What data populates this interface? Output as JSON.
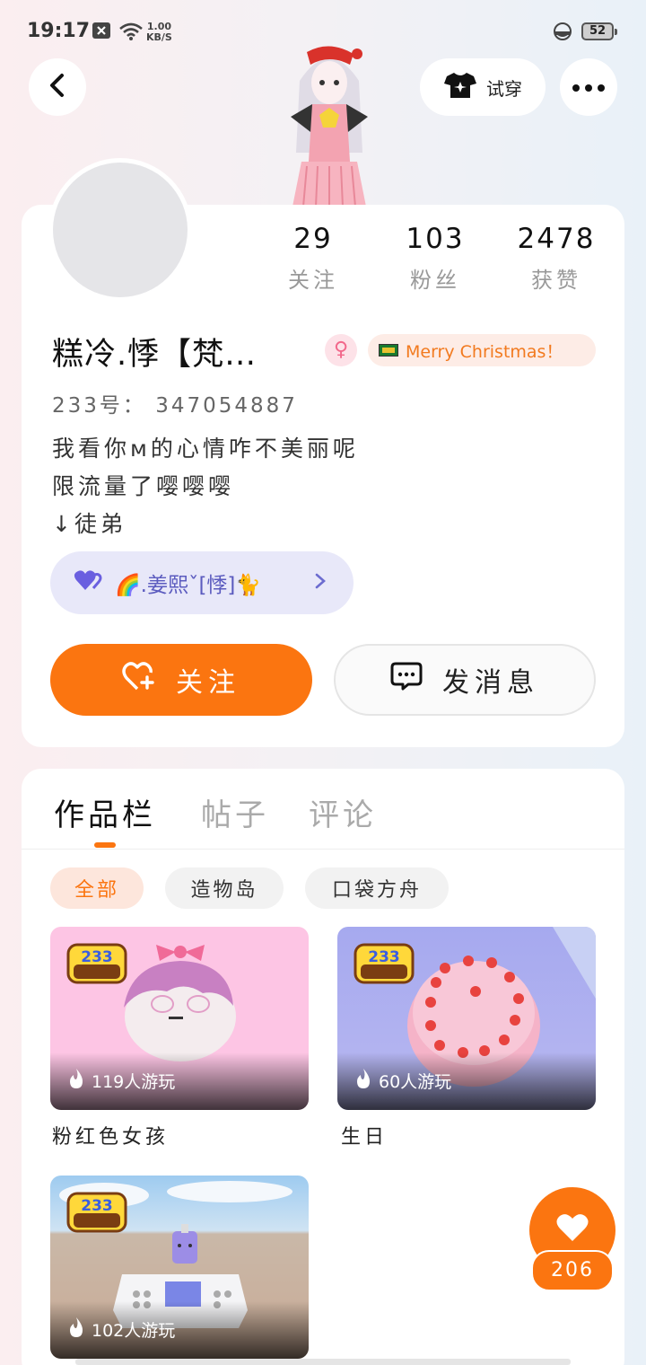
{
  "status_bar": {
    "time": "19:17",
    "net_speed_value": "1.00",
    "net_speed_unit": "KB/S",
    "battery": "52"
  },
  "header": {
    "try_on_label": "试穿"
  },
  "stats": [
    {
      "value": "29",
      "label": "关注"
    },
    {
      "value": "103",
      "label": "粉丝"
    },
    {
      "value": "2478",
      "label": "获赞"
    }
  ],
  "profile": {
    "nickname": "糕冷.悸【梵…",
    "gender_symbol": "♀",
    "badge_text": "Merry Christmas！",
    "uid": "233号： 347054887",
    "bio_lines": [
      "我看你м的心情咋不美丽呢",
      "限流量了嘤嘤嘤",
      "↓徒弟"
    ],
    "friend_name": "🌈.姜熙ˇ[悸]🐈",
    "follow_label": "关注",
    "message_label": "发消息"
  },
  "tabs": [
    "作品栏",
    "帖子",
    "评论"
  ],
  "filters": [
    "全部",
    "造物岛",
    "口袋方舟"
  ],
  "games": [
    {
      "title": "粉红色女孩",
      "plays": "119人游玩"
    },
    {
      "title": "生日",
      "plays": "60人游玩"
    },
    {
      "title": "",
      "plays": "102人游玩"
    }
  ],
  "like_count": "206",
  "colors": {
    "accent": "#fb7510",
    "friend_pill": "#e8e8f9",
    "badge_bg": "#fdece6"
  }
}
